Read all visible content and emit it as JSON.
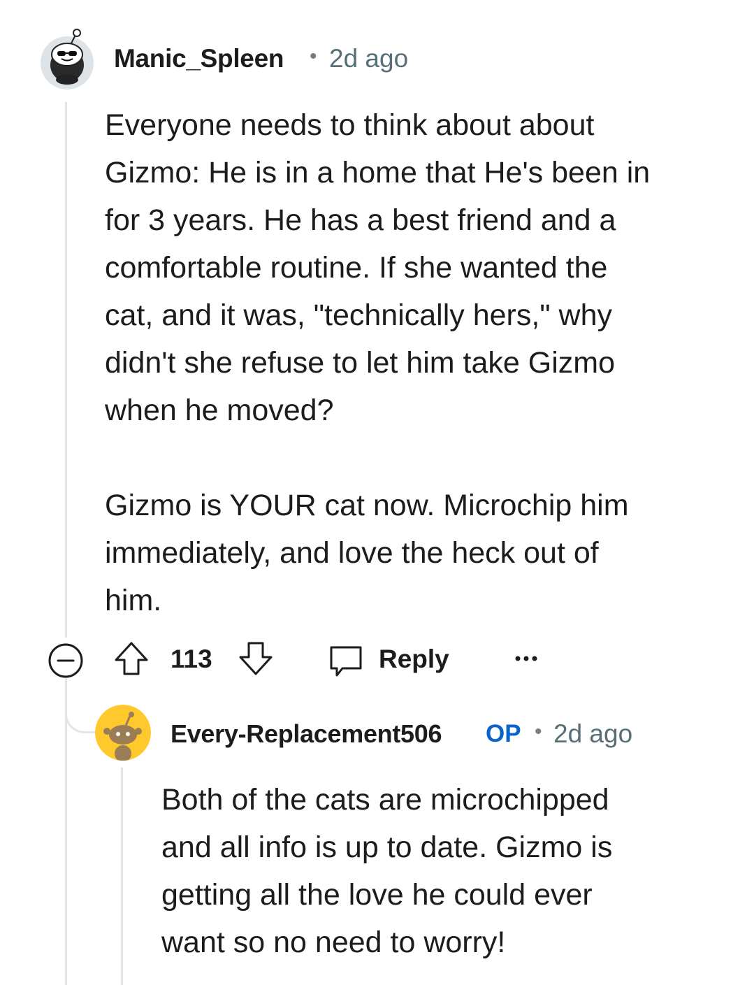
{
  "comment": {
    "author": "Manic_Spleen",
    "separator": "•",
    "time": "2d ago",
    "paragraphs": [
      "Everyone needs to think about about\nGizmo: He is in a home that He's been in\nfor 3 years. He has a best friend and a\ncomfortable routine. If she wanted the\ncat, and it was, \"technically hers,\" why\ndidn't she refuse to let him take Gizmo\nwhen he moved?",
      "Gizmo is YOUR cat now. Microchip him\nimmediately, and love the heck out of\nhim."
    ],
    "actions": {
      "collapse_icon": "minus-circle-icon",
      "upvote_icon": "arrow-up-icon",
      "score": "113",
      "downvote_icon": "arrow-down-icon",
      "reply_icon": "speech-bubble-icon",
      "reply_label": "Reply",
      "more_icon": "ellipsis-icon"
    }
  },
  "reply": {
    "author": "Every-Replacement506",
    "badge": "OP",
    "separator": "•",
    "time": "2d ago",
    "paragraphs": [
      "Both of the cats are microchipped\nand all info is up to date. Gizmo is\ngetting all the love he could ever\nwant so no need to worry!"
    ]
  },
  "colors": {
    "op_badge": "#0a63c9",
    "thread_line": "#e2e5e8",
    "reply_avatar_bg": "#ffc92e",
    "muted_text": "#576f76"
  }
}
